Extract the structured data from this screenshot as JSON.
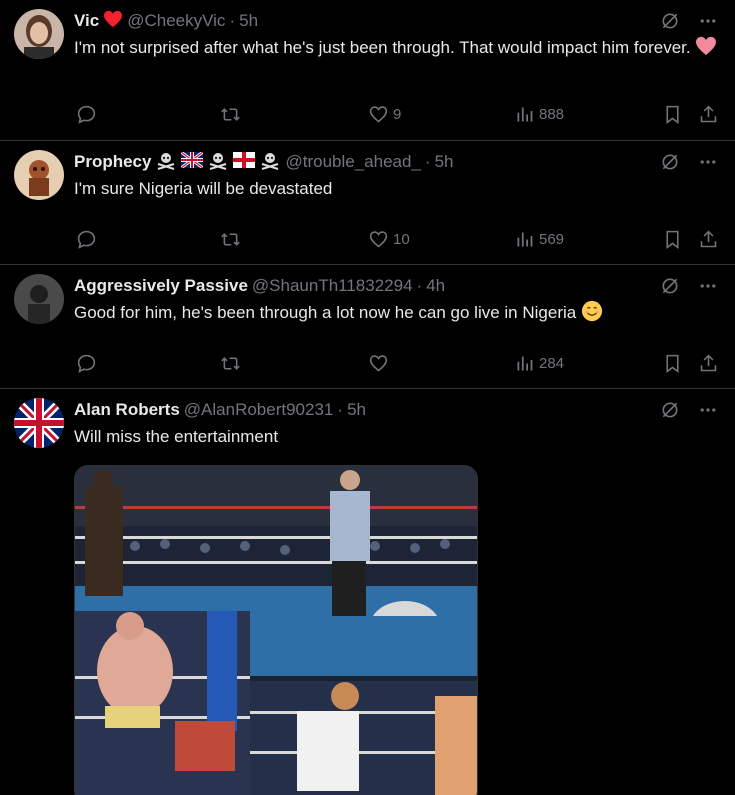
{
  "tweets": [
    {
      "name": "Vic",
      "handle": "@CheekyVic",
      "time": "5h",
      "text": "I'm not surprised after what he's just been through. That would impact him forever.",
      "likes": "9",
      "views": "888",
      "avatar_color": "#8a6a58"
    },
    {
      "name": "Prophecy",
      "handle": "@trouble_ahead_",
      "time": "5h",
      "text": "I'm sure Nigeria will be devastated",
      "likes": "10",
      "views": "569",
      "avatar_color": "#9a5a36"
    },
    {
      "name": "Aggressively Passive",
      "handle": "@ShaunTh11832294",
      "time": "4h",
      "text": "Good for him, he's been through a lot now he can go live in Nigeria",
      "likes": "",
      "views": "284",
      "avatar_color": "#3a3a3a"
    },
    {
      "name": "Alan Roberts",
      "handle": "@AlanRobert90231",
      "time": "5h",
      "text": "Will miss the entertainment",
      "avatar_color": "#2a3f9e"
    }
  ],
  "colors": {
    "background": "#000000",
    "text": "#e7e9ea",
    "muted": "#71767b",
    "divider": "#2f3336",
    "heart": "#f4212e"
  },
  "icons": [
    "reply-icon",
    "retweet-icon",
    "like-icon",
    "views-icon",
    "bookmark-icon",
    "share-icon",
    "grok-icon",
    "more-icon"
  ]
}
